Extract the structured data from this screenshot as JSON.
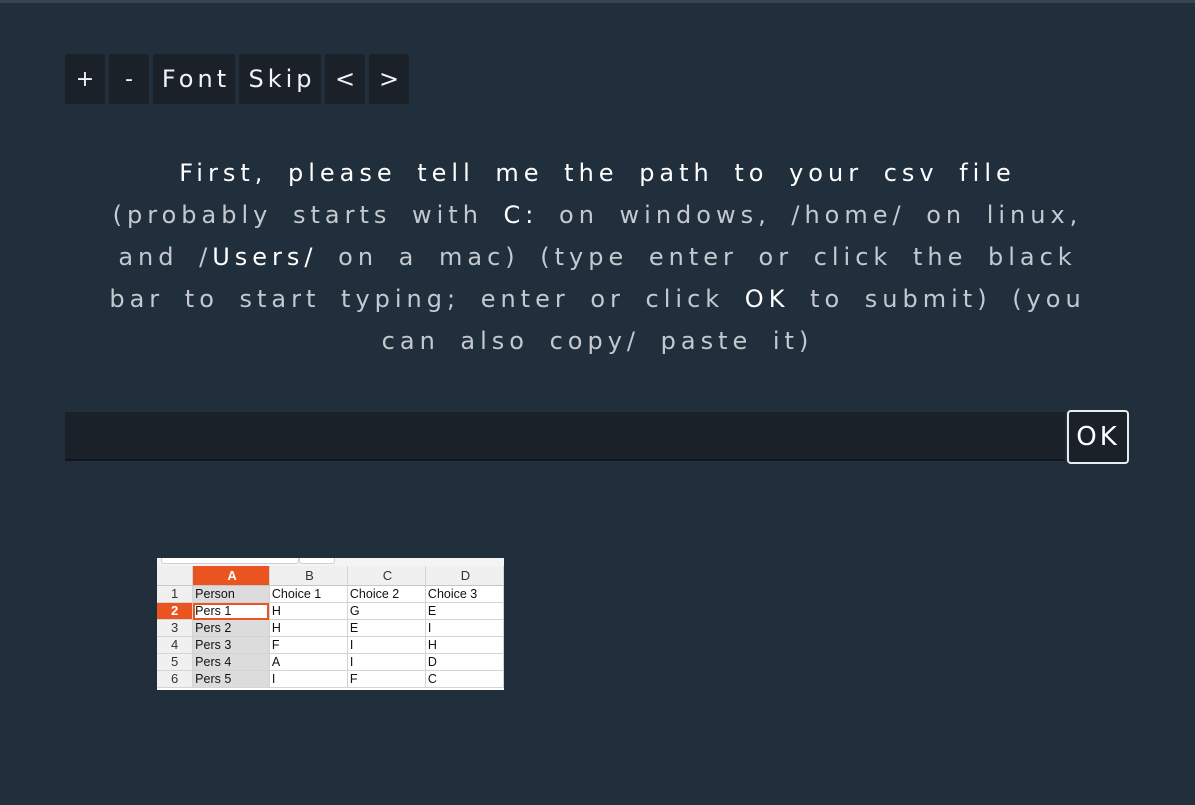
{
  "toolbar": {
    "increase_font_label": "+",
    "decrease_font_label": "-",
    "font_label": "Font",
    "skip_label": "Skip",
    "previous_label": "<",
    "next_label": ">"
  },
  "prompt": {
    "lead": "First, please tell me the path to your csv file",
    "part1": " (probably starts with ",
    "drive": "C:",
    "part2": " on windows, /home/ on linux, and /",
    "users": "Users/",
    "part3": " on a mac) (type enter or click the black bar to start typing; enter or click ",
    "ok": "OK",
    "part4": " to submit) (you can also copy/ paste it)"
  },
  "path_input": {
    "value": "",
    "placeholder": ""
  },
  "ok_button": {
    "label": "OK"
  },
  "example_sheet": {
    "column_headers": [
      "A",
      "B",
      "C",
      "D"
    ],
    "rows": [
      {
        "num": "1",
        "cells": [
          "Person",
          "Choice 1",
          "Choice 2",
          "Choice 3"
        ]
      },
      {
        "num": "2",
        "cells": [
          "Pers 1",
          "H",
          "G",
          "E"
        ]
      },
      {
        "num": "3",
        "cells": [
          "Pers 2",
          "H",
          "E",
          "I"
        ]
      },
      {
        "num": "4",
        "cells": [
          "Pers 3",
          "F",
          "I",
          "H"
        ]
      },
      {
        "num": "5",
        "cells": [
          "Pers 4",
          "A",
          "I",
          "D"
        ]
      },
      {
        "num": "6",
        "cells": [
          "Pers 5",
          "I",
          "F",
          "C"
        ]
      }
    ],
    "active_column": "A",
    "active_row": "2",
    "accent_color": "#e95420"
  },
  "colors": {
    "background": "#212e3c",
    "button_background": "#1b2129",
    "text_muted": "#c3c9cf",
    "text_strong": "#ffffff"
  }
}
